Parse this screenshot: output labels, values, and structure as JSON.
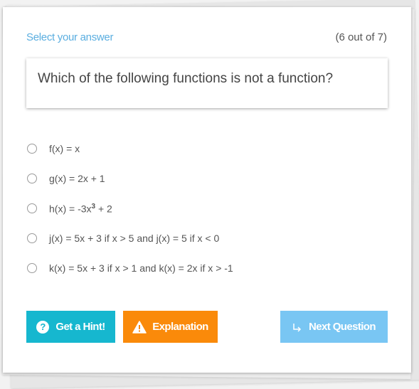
{
  "header": {
    "select_label": "Select your answer",
    "progress": "(6 out of 7)"
  },
  "question": {
    "text": "Which of the following functions is not a function?"
  },
  "options": [
    {
      "text": "f(x) = x"
    },
    {
      "text": "g(x) = 2x + 1"
    },
    {
      "text_before": "h(x) = -3x",
      "sup": "3",
      "text_after": " + 2"
    },
    {
      "text": "j(x) = 5x + 3 if x > 5 and j(x) = 5 if x < 0"
    },
    {
      "text": "k(x) = 5x + 3 if x > 1 and k(x) = 2x if x > -1"
    }
  ],
  "buttons": {
    "hint_label": "Get a Hint!",
    "hint_icon_glyph": "?",
    "explanation_label": "Explanation",
    "next_label": "Next Question"
  },
  "icons": {
    "hint": "question-circle-icon",
    "explanation": "warning-icon",
    "next": "share-arrow-icon"
  },
  "colors": {
    "accent_label": "#5aaee0",
    "hint_button": "#16b7cf",
    "explanation_button": "#fa8a0a",
    "next_button": "#79c6f3"
  }
}
